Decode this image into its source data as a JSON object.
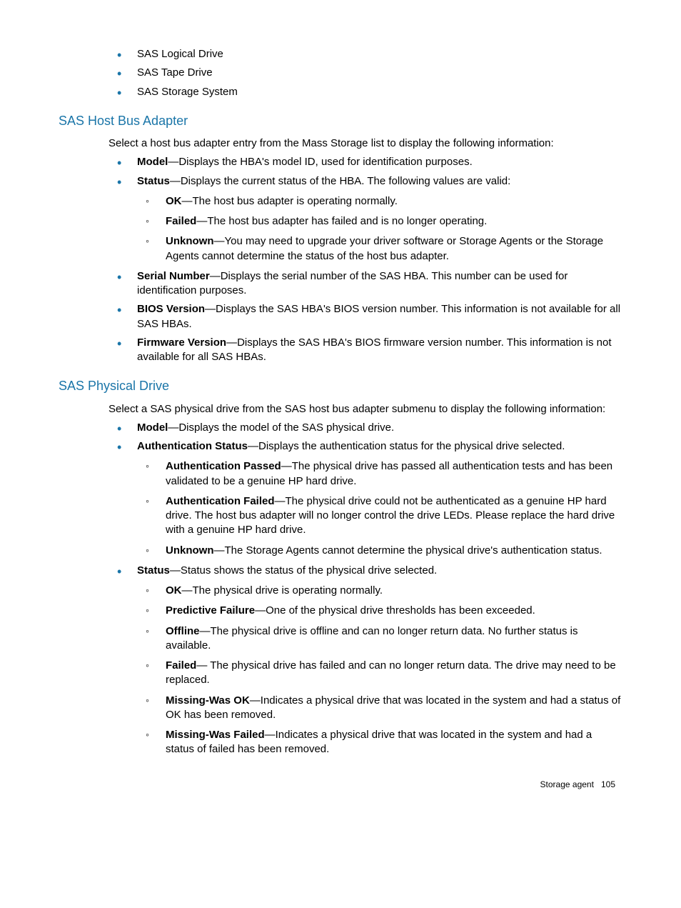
{
  "top_list": [
    "SAS Logical Drive",
    "SAS Tape Drive",
    "SAS Storage System"
  ],
  "sec1": {
    "title": "SAS Host Bus Adapter",
    "intro": "Select a host bus adapter entry from the Mass Storage list to display the following information:",
    "items": {
      "model": {
        "label": "Model",
        "text": "—Displays the HBA's model ID, used for identification purposes."
      },
      "status": {
        "label": "Status",
        "text": "—Displays the current status of the HBA. The following values are valid:",
        "sub": {
          "ok": {
            "label": "OK",
            "text": "—The host bus adapter is operating normally."
          },
          "failed": {
            "label": "Failed",
            "text": "—The host bus adapter has failed and is no longer operating."
          },
          "unk": {
            "label": "Unknown",
            "text": "—You may need to upgrade your driver software or Storage Agents or the Storage Agents cannot determine the status of the host bus adapter."
          }
        }
      },
      "serial": {
        "label": "Serial Number",
        "text": "—Displays the serial number of the SAS HBA. This number can be used for identification purposes."
      },
      "bios": {
        "label": "BIOS Version",
        "text": "—Displays the SAS HBA's BIOS version number. This information is not available for all SAS HBAs."
      },
      "fw": {
        "label": "Firmware Version",
        "text": "—Displays the SAS HBA's BIOS firmware version number. This information is not available for all SAS HBAs."
      }
    }
  },
  "sec2": {
    "title": "SAS Physical Drive",
    "intro": "Select a SAS physical drive from the SAS host bus adapter submenu to display the following information:",
    "items": {
      "model": {
        "label": "Model",
        "text": "—Displays the model of the SAS physical drive."
      },
      "auth": {
        "label": "Authentication Status",
        "text": "—Displays the authentication status for the physical drive selected.",
        "sub": {
          "pass": {
            "label": "Authentication Passed",
            "text": "—The physical drive has passed all authentication tests and has been validated to be a genuine HP hard drive."
          },
          "fail": {
            "label": "Authentication Failed",
            "text": "—The physical drive could not be authenticated as a genuine HP hard drive. The host bus adapter will no longer control the drive LEDs. Please replace the hard drive with a genuine HP hard drive."
          },
          "unk": {
            "label": "Unknown",
            "text": "—The Storage Agents cannot determine the physical drive's authentication status."
          }
        }
      },
      "status": {
        "label": "Status",
        "text": "—Status shows the status of the physical drive selected.",
        "sub": {
          "ok": {
            "label": "OK",
            "text": "—The physical drive is operating normally."
          },
          "pred": {
            "label": "Predictive Failure",
            "text": "—One of the physical drive thresholds has been exceeded."
          },
          "off": {
            "label": "Offline",
            "text": "—The physical drive is offline and can no longer return data. No further status is available."
          },
          "fail": {
            "label": "Failed",
            "text": "— The physical drive has failed and can no longer return data. The drive may need to be replaced."
          },
          "mok": {
            "label": "Missing-Was OK",
            "text": "—Indicates a physical drive that was located in the system and had a status of OK has been removed."
          },
          "mfail": {
            "label": "Missing-Was Failed",
            "text": "—Indicates a physical drive that was located in the system and had a status of failed has been removed."
          }
        }
      }
    }
  },
  "footer": {
    "label": "Storage agent",
    "page": "105"
  }
}
